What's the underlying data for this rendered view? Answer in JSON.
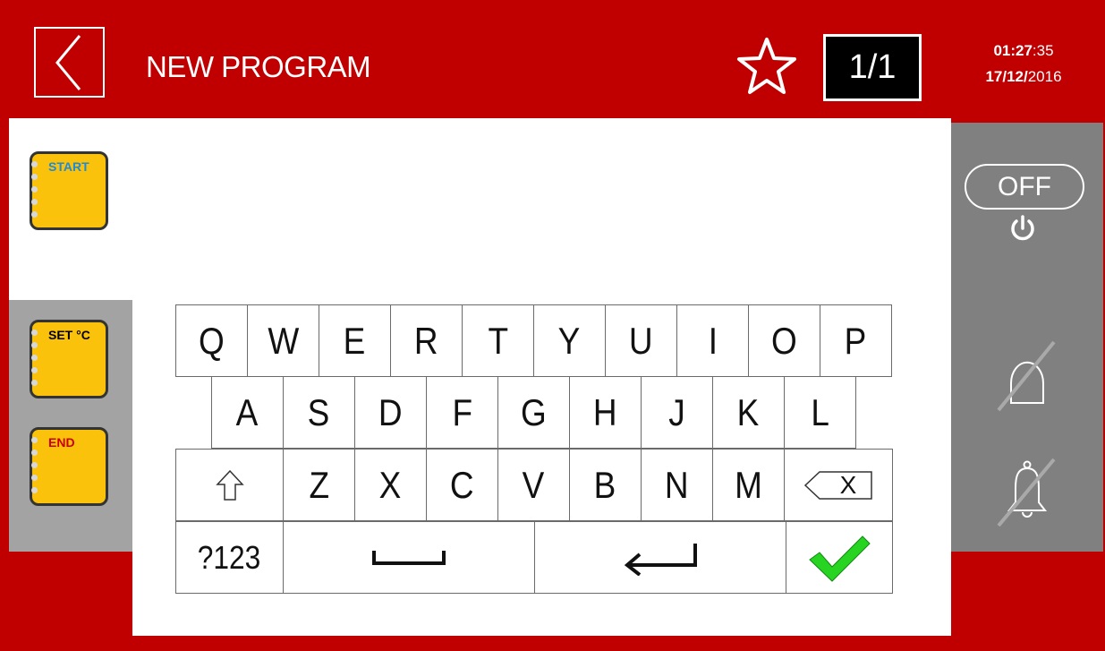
{
  "header": {
    "title": "NEW PROGRAM",
    "page_indicator": "1/1",
    "time_hm": "01:27",
    "time_sec": ":35",
    "date_dm": "17/12/",
    "date_year": "2016"
  },
  "left_panel": {
    "start_label": "START",
    "set_temp_label": "SET °C",
    "end_label": "END"
  },
  "right_panel": {
    "off_label": "OFF"
  },
  "keyboard": {
    "row1": [
      "Q",
      "W",
      "E",
      "R",
      "T",
      "Y",
      "U",
      "I",
      "O",
      "P"
    ],
    "row2": [
      "A",
      "S",
      "D",
      "F",
      "G",
      "H",
      "J",
      "K",
      "L"
    ],
    "row3": [
      "Z",
      "X",
      "C",
      "V",
      "B",
      "N",
      "M"
    ],
    "backspace_label": "X",
    "numbers_label": "?123"
  },
  "colors": {
    "header_bg": "#c00000",
    "accent_yellow": "#fac20a",
    "label_blue": "#1f8ad6",
    "label_red": "#cc0000",
    "confirm_green": "#27d421"
  }
}
